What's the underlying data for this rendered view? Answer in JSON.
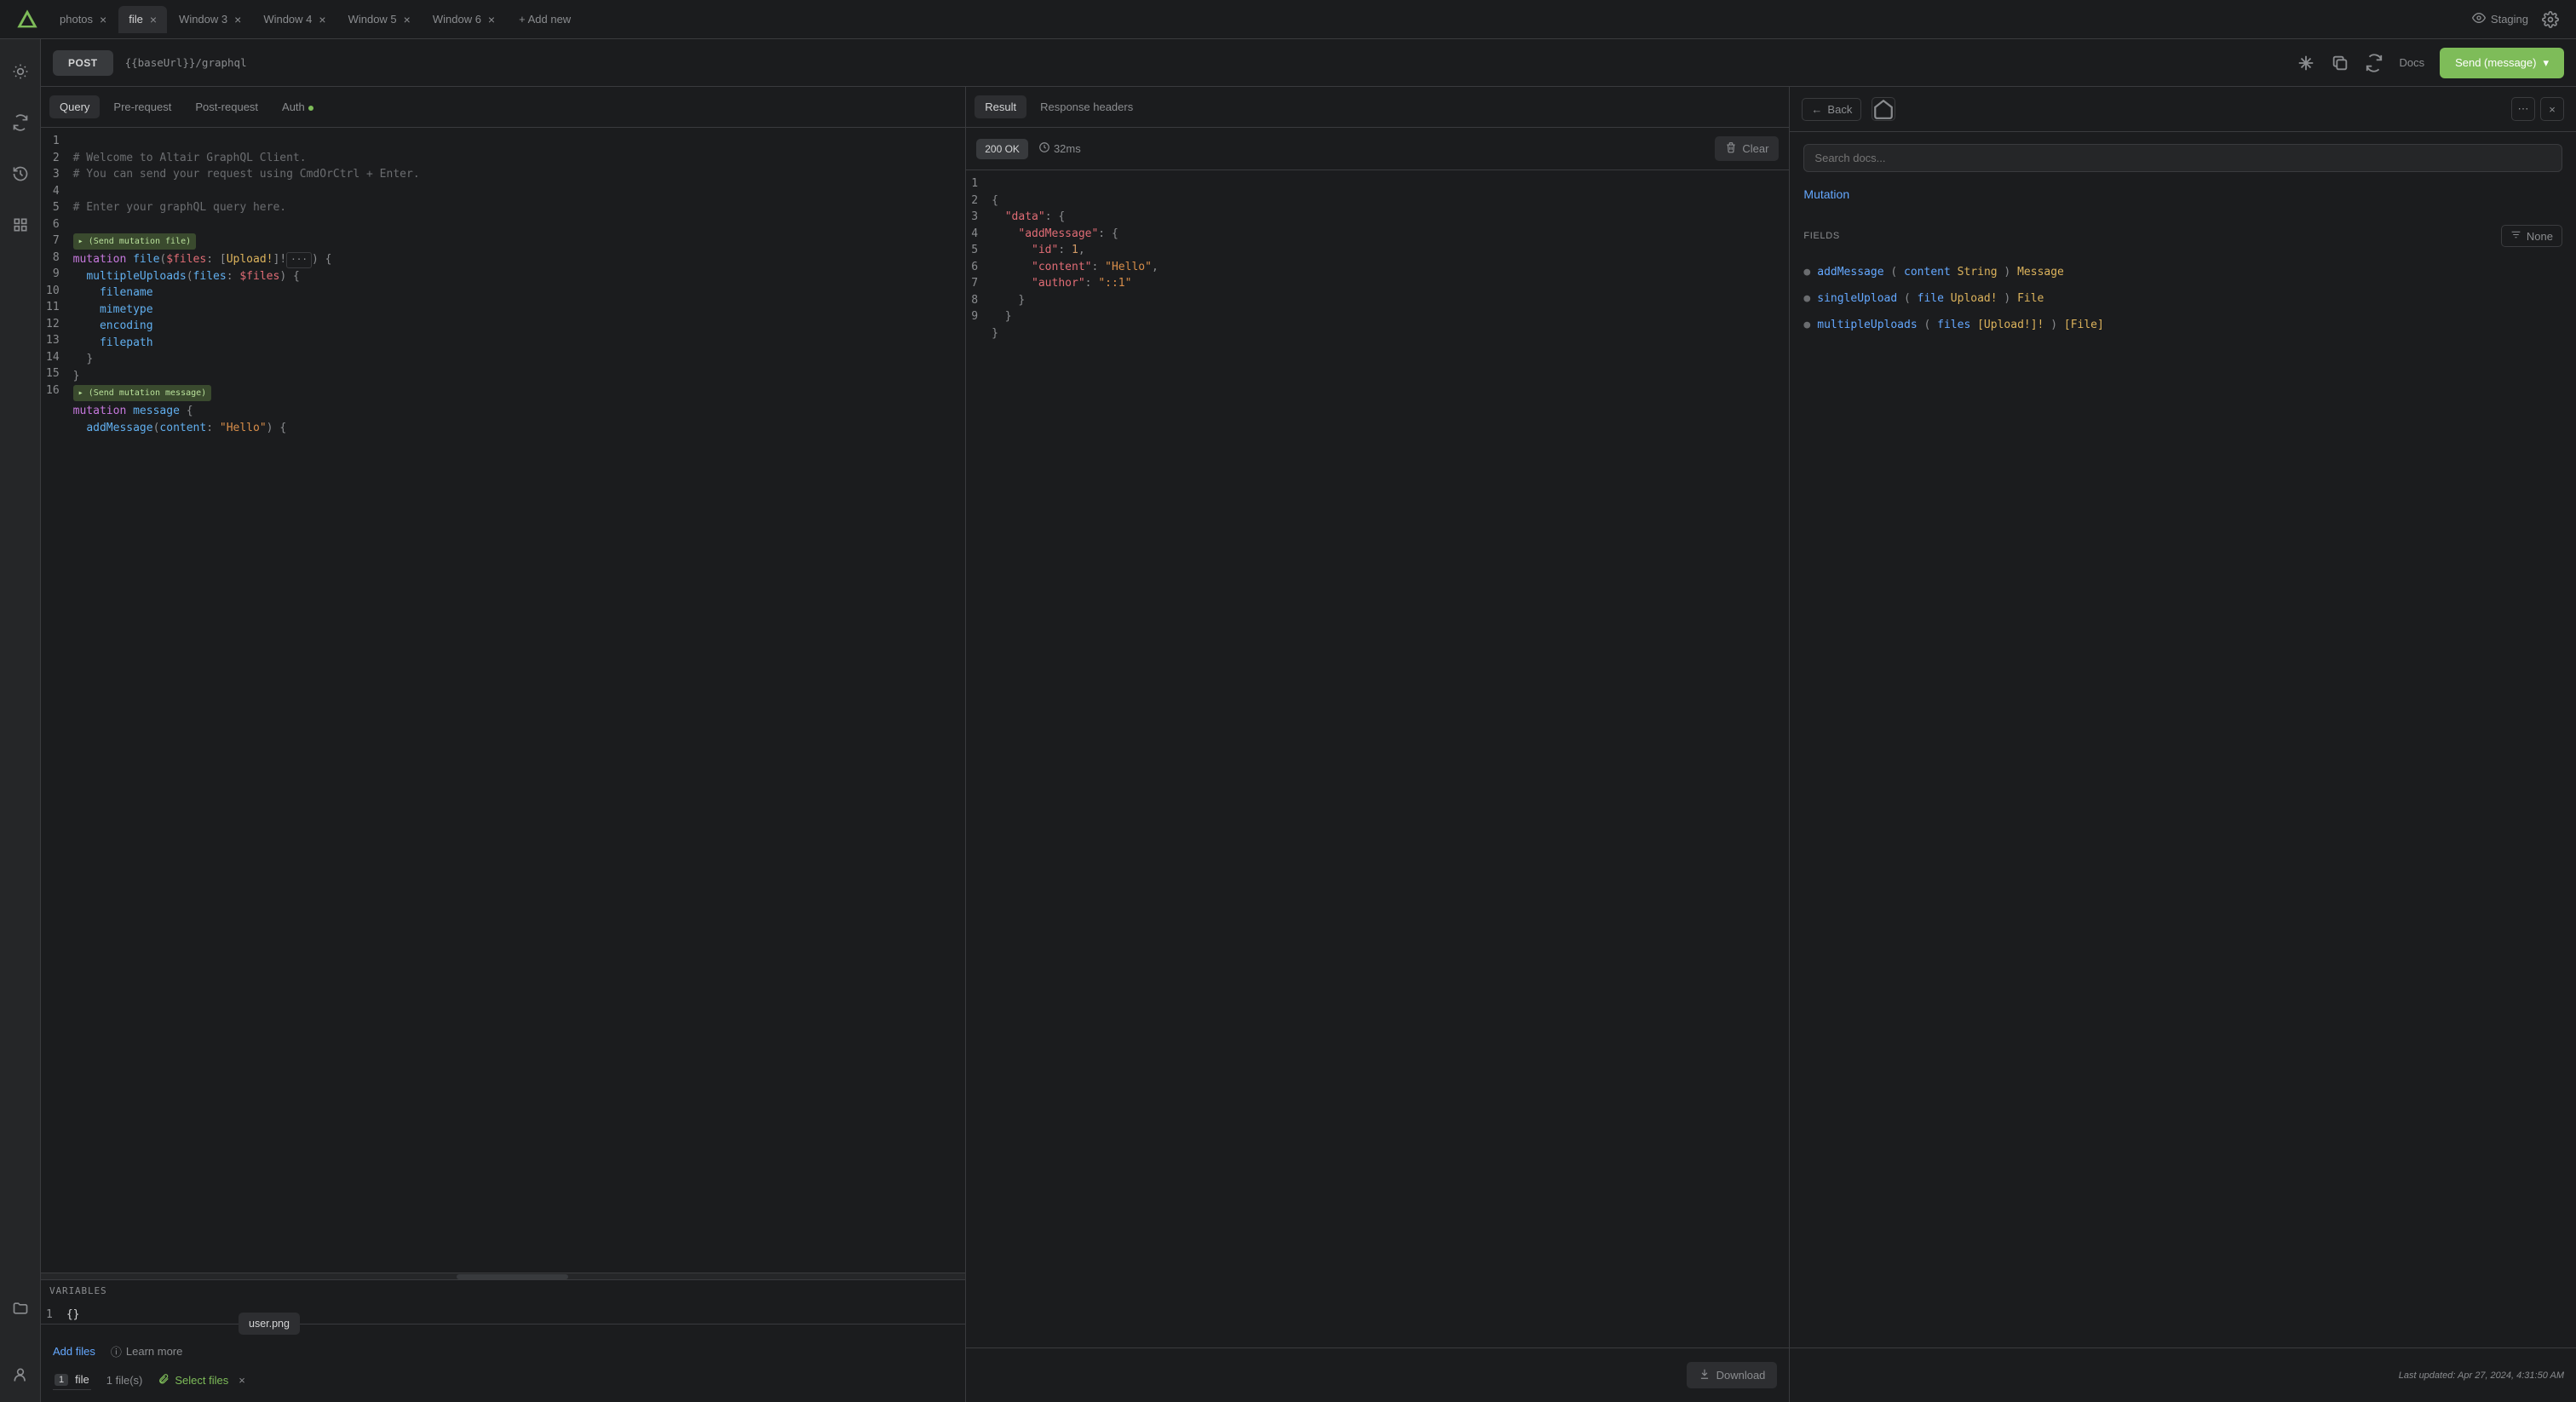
{
  "tabs": {
    "items": [
      {
        "label": "photos"
      },
      {
        "label": "file"
      },
      {
        "label": "Window 3"
      },
      {
        "label": "Window 4"
      },
      {
        "label": "Window 5"
      },
      {
        "label": "Window 6"
      }
    ],
    "active_index": 1,
    "add_new": "+ Add new"
  },
  "header_right": {
    "staging": "Staging"
  },
  "urlbar": {
    "method": "POST",
    "base_var": "{{baseUrl}}",
    "path": "/graphql",
    "docs": "Docs",
    "send_label": "Send (message)"
  },
  "query_pane": {
    "tabs": {
      "query": "Query",
      "pre": "Pre-request",
      "post": "Post-request",
      "auth": "Auth"
    },
    "lines": [
      "# Welcome to Altair GraphQL Client.",
      "# You can send your request using CmdOrCtrl + Enter.",
      "",
      "# Enter your graphQL query here.",
      ""
    ],
    "badge_file": "(Send mutation file)",
    "code_file": {
      "l6": {
        "kw": "mutation",
        "name": "file",
        "args_pre": "(",
        "var": "$files",
        "colon": ": [",
        "type": "Upload!",
        "close": "]!",
        "ell": "···",
        "tail": ") {"
      },
      "l7": {
        "fn": "multipleUploads",
        "open": "(",
        "arg": "files",
        "colon": ": ",
        "var": "$files",
        "close": ") {"
      },
      "l8": "filename",
      "l9": "mimetype",
      "l10": "encoding",
      "l11": "filepath",
      "l12": "}",
      "l13": "}"
    },
    "badge_msg": "(Send mutation message)",
    "code_msg": {
      "l15": {
        "kw": "mutation",
        "name": "message",
        "tail": " {"
      },
      "l16": {
        "fn": "addMessage",
        "open": "(",
        "arg": "content",
        "colon": ": ",
        "val": "\"Hello\"",
        "close": ") {"
      }
    },
    "variables_label": "VARIABLES",
    "variables_body": "{}"
  },
  "result_pane": {
    "tabs": {
      "result": "Result",
      "headers": "Response headers"
    },
    "status": "200 OK",
    "time": "32ms",
    "clear": "Clear",
    "json": {
      "l1": "{",
      "l2_k": "\"data\"",
      "l2_t": ": {",
      "l3_k": "\"addMessage\"",
      "l3_t": ": {",
      "l4_k": "\"id\"",
      "l4_v": "1",
      "l4_t": ",",
      "l5_k": "\"content\"",
      "l5_v": "\"Hello\"",
      "l5_t": ",",
      "l6_k": "\"author\"",
      "l6_v": "\"::1\"",
      "l7": "}",
      "l8": "}",
      "l9": "}"
    }
  },
  "docs_pane": {
    "back": "Back",
    "search_placeholder": "Search docs...",
    "crumb": "Mutation",
    "fields_label": "FIELDS",
    "none": "None",
    "fields": [
      {
        "name": "addMessage",
        "args": [
          {
            "name": "content",
            "type": "String"
          }
        ],
        "ret": "Message"
      },
      {
        "name": "singleUpload",
        "args": [
          {
            "name": "file",
            "type": "Upload!"
          }
        ],
        "ret": "File"
      },
      {
        "name": "multipleUploads",
        "args": [
          {
            "name": "files",
            "type": "[Upload!]!"
          }
        ],
        "ret": "[File]"
      }
    ]
  },
  "bottom": {
    "add_files": "Add files",
    "learn_more": "Learn more",
    "pill": "user.png",
    "file_input_num": "1",
    "file_input_name": "file",
    "file_count": "1 file(s)",
    "select_files": "Select files",
    "download": "Download",
    "timestamp": "Last updated: Apr 27, 2024, 4:31:50 AM"
  }
}
